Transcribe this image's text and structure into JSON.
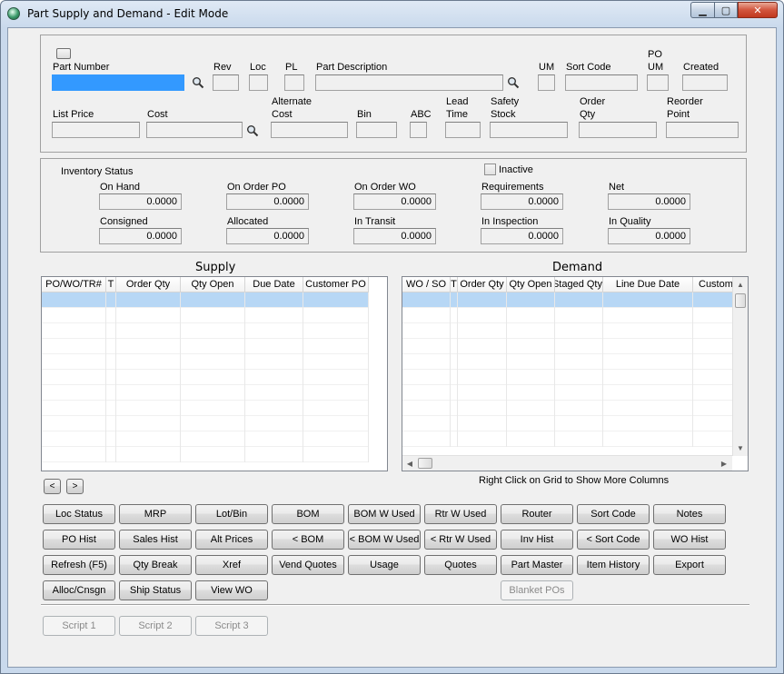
{
  "window": {
    "title": "Part Supply and Demand - Edit Mode",
    "min": "▁",
    "max": "▢",
    "close": "✕"
  },
  "part": {
    "labels": {
      "part_number": "Part Number",
      "rev": "Rev",
      "loc": "Loc",
      "pl": "PL",
      "description": "Part Description",
      "um": "UM",
      "sort_code": "Sort Code",
      "po_um_1": "PO",
      "po_um_2": "UM",
      "created": "Created",
      "list_price": "List Price",
      "cost": "Cost",
      "alt_cost_1": "Alternate",
      "alt_cost_2": "Cost",
      "bin": "Bin",
      "abc": "ABC",
      "lead_1": "Lead",
      "lead_2": "Time",
      "safety_1": "Safety",
      "safety_2": "Stock",
      "order_qty_1": "Order",
      "order_qty_2": "Qty",
      "reorder_1": "Reorder",
      "reorder_2": "Point"
    },
    "values": {
      "part_number": "",
      "rev": "",
      "loc": "",
      "pl": "",
      "description": "",
      "um": "",
      "sort_code": "",
      "po_um": "",
      "created": "",
      "list_price": "",
      "cost": "",
      "alt_cost": "",
      "bin": "",
      "abc": "",
      "lead_time": "",
      "safety_stock": "",
      "order_qty": "",
      "reorder_point": ""
    }
  },
  "inventory": {
    "title": "Inventory Status",
    "inactive_label": "Inactive",
    "inactive_checked": false,
    "fields": [
      {
        "label": "On Hand",
        "value": "0.0000"
      },
      {
        "label": "On Order PO",
        "value": "0.0000"
      },
      {
        "label": "On Order WO",
        "value": "0.0000"
      },
      {
        "label": "Requirements",
        "value": "0.0000"
      },
      {
        "label": "Net",
        "value": "0.0000"
      },
      {
        "label": "Consigned",
        "value": "0.0000"
      },
      {
        "label": "Allocated",
        "value": "0.0000"
      },
      {
        "label": "In Transit",
        "value": "0.0000"
      },
      {
        "label": "In Inspection",
        "value": "0.0000"
      },
      {
        "label": "In Quality",
        "value": "0.0000"
      }
    ]
  },
  "supply": {
    "title": "Supply",
    "columns": [
      "PO/WO/TR#",
      "T",
      "Order Qty",
      "Qty Open",
      "Due Date",
      "Customer PO"
    ]
  },
  "demand": {
    "title": "Demand",
    "columns": [
      "WO / SO",
      "T",
      "Order Qty",
      "Qty Open",
      "Staged Qty",
      "Line Due Date",
      "Customer"
    ],
    "hint": "Right Click on Grid to Show More Columns"
  },
  "nav": {
    "prev": "<",
    "next": ">"
  },
  "buttons": {
    "row1": [
      "Loc Status",
      "MRP",
      "Lot/Bin",
      "BOM",
      "BOM W Used",
      "Rtr W Used",
      "Router",
      "Sort Code",
      "Notes"
    ],
    "row2": [
      "PO Hist",
      "Sales Hist",
      "Alt Prices",
      "< BOM",
      "< BOM W Used",
      "< Rtr W Used",
      "Inv Hist",
      "< Sort Code",
      "WO Hist"
    ],
    "row3": [
      "Refresh (F5)",
      "Qty Break",
      "Xref",
      "Vend Quotes",
      "Usage",
      "Quotes",
      "Part Master",
      "Item History",
      "Export"
    ],
    "row4": [
      "Alloc/Cnsgn",
      "Ship Status",
      "View WO"
    ],
    "blanket_pos": "Blanket POs",
    "scripts": [
      "Script 1",
      "Script 2",
      "Script 3"
    ]
  }
}
